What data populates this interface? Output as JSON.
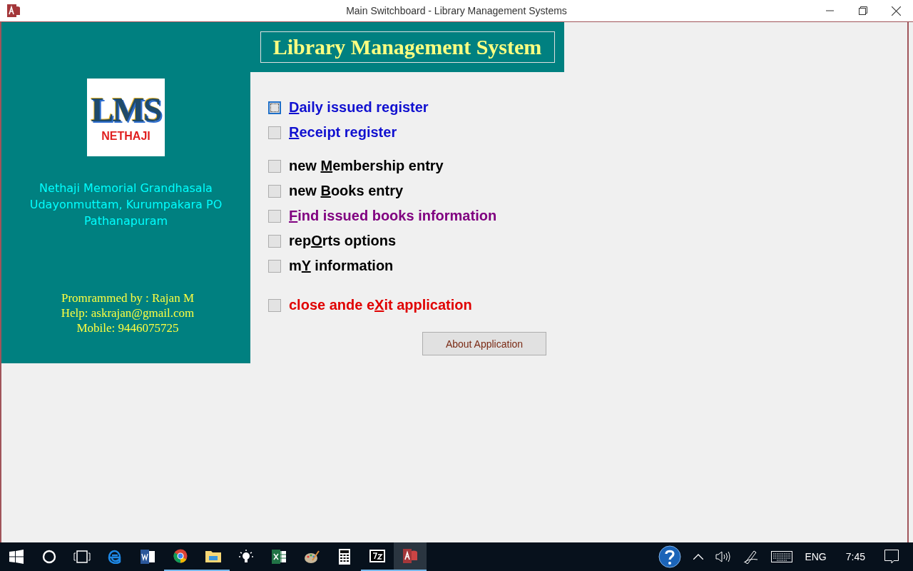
{
  "window": {
    "title": "Main Switchboard - Library Management Systems"
  },
  "header": {
    "title": "Library Management System"
  },
  "logo": {
    "letters": "LMS",
    "caption": "NETHAJI"
  },
  "address": [
    "Nethaji Memorial Grandhasala",
    "Udayonmuttam, Kurumpakara PO",
    "Pathanapuram"
  ],
  "credits": [
    "Promrammed by : Rajan M",
    "Help: askrajan@gmail.com",
    "Mobile: 9446075725"
  ],
  "menu": [
    {
      "key": "D",
      "suffix": "aily issued register",
      "color": "#1010d0",
      "selected": true,
      "kind": "register"
    },
    {
      "key": "R",
      "suffix": "eceipt register",
      "color": "#1010d0",
      "selected": false,
      "kind": "register"
    },
    {
      "prefix": "new ",
      "key": "M",
      "suffix": "embership entry",
      "color": "#000000",
      "selected": false,
      "kind": "task"
    },
    {
      "prefix": "new ",
      "key": "B",
      "suffix": "ooks entry",
      "color": "#000000",
      "selected": false,
      "kind": "task"
    },
    {
      "key": "F",
      "suffix": "ind issued books information",
      "color": "#800080",
      "selected": false,
      "kind": "task"
    },
    {
      "prefix": "rep",
      "key": "O",
      "suffix": "rts options",
      "color": "#000000",
      "selected": false,
      "kind": "task"
    },
    {
      "prefix": "m",
      "key": "Y",
      "suffix": " information",
      "color": "#000000",
      "selected": false,
      "kind": "task"
    },
    {
      "prefix": "close ande e",
      "key": "X",
      "suffix": "it application",
      "color": "#e00000",
      "selected": false,
      "kind": "exit"
    }
  ],
  "about_button": "About Application",
  "taskbar": {
    "apps": [
      {
        "kind": "start",
        "running": false,
        "active": false
      },
      {
        "kind": "search",
        "running": false,
        "active": false
      },
      {
        "kind": "taskview",
        "running": false,
        "active": false
      },
      {
        "kind": "edge",
        "running": false,
        "active": false
      },
      {
        "kind": "word",
        "running": false,
        "active": false
      },
      {
        "kind": "chrome",
        "running": true,
        "active": false
      },
      {
        "kind": "folder",
        "running": true,
        "active": false
      },
      {
        "kind": "bulb",
        "running": false,
        "active": false
      },
      {
        "kind": "excel",
        "running": false,
        "active": false
      },
      {
        "kind": "paint",
        "running": false,
        "active": false
      },
      {
        "kind": "calculator",
        "running": false,
        "active": false
      },
      {
        "kind": "zip",
        "running": true,
        "active": false
      },
      {
        "kind": "access",
        "running": true,
        "active": true
      }
    ],
    "language": "ENG",
    "time": "7:45"
  }
}
